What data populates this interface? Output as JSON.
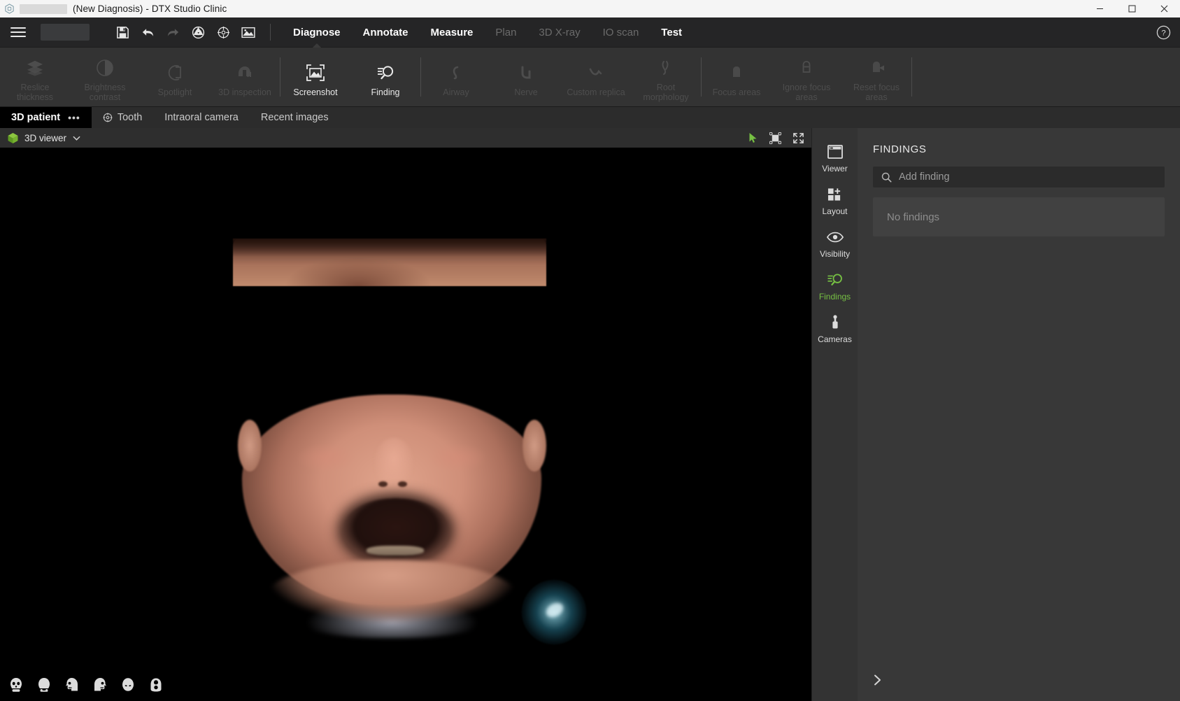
{
  "titlebar": {
    "app_icon": "dtx-app-icon",
    "patient_name_redacted": "",
    "title": "(New Diagnosis) - DTX Studio Clinic",
    "window_controls": [
      {
        "name": "minimize",
        "glyph": "minimize-icon"
      },
      {
        "name": "maximize",
        "glyph": "maximize-icon"
      },
      {
        "name": "close",
        "glyph": "close-icon"
      }
    ]
  },
  "menubar": {
    "hamburger": "hamburger-menu-icon",
    "tools": [
      {
        "name": "save-icon",
        "label": "Save",
        "disabled": false
      },
      {
        "name": "undo-icon",
        "label": "Undo",
        "disabled": false
      },
      {
        "name": "redo-icon",
        "label": "Redo",
        "disabled": true
      },
      {
        "name": "aperture-icon",
        "label": "Capture",
        "disabled": false
      },
      {
        "name": "crosshair-icon",
        "label": "Target",
        "disabled": false
      },
      {
        "name": "image-icon",
        "label": "Image",
        "disabled": false
      }
    ],
    "items": [
      {
        "label": "Diagnose",
        "active": true,
        "disabled": false
      },
      {
        "label": "Annotate",
        "active": false,
        "disabled": false
      },
      {
        "label": "Measure",
        "active": false,
        "disabled": false
      },
      {
        "label": "Plan",
        "active": false,
        "disabled": true
      },
      {
        "label": "3D X-ray",
        "active": false,
        "disabled": true
      },
      {
        "label": "IO scan",
        "active": false,
        "disabled": true
      },
      {
        "label": "Test",
        "active": false,
        "disabled": false
      }
    ],
    "help": "help-icon"
  },
  "ribbon": {
    "groups": [
      {
        "items": [
          {
            "label": "Reslice thickness",
            "icon": "layers-icon",
            "disabled": true
          },
          {
            "label": "Brightness contrast",
            "icon": "contrast-icon",
            "disabled": true
          },
          {
            "label": "Spotlight",
            "icon": "spotlight-icon",
            "disabled": true
          },
          {
            "label": "3D inspection",
            "icon": "inspection-icon",
            "disabled": true
          }
        ]
      },
      {
        "items": [
          {
            "label": "Screenshot",
            "icon": "screenshot-icon",
            "disabled": false
          },
          {
            "label": "Finding",
            "icon": "finding-icon",
            "disabled": false
          }
        ]
      },
      {
        "items": [
          {
            "label": "Airway",
            "icon": "airway-icon",
            "disabled": true
          },
          {
            "label": "Nerve",
            "icon": "nerve-icon",
            "disabled": true
          },
          {
            "label": "Custom replica",
            "icon": "replica-icon",
            "disabled": true
          },
          {
            "label": "Root morphology",
            "icon": "root-icon",
            "disabled": true
          }
        ]
      },
      {
        "items": [
          {
            "label": "Focus areas",
            "icon": "focus-area-icon",
            "disabled": true
          },
          {
            "label": "Ignore focus areas",
            "icon": "ignore-focus-icon",
            "disabled": true
          },
          {
            "label": "Reset focus areas",
            "icon": "reset-focus-icon",
            "disabled": true
          }
        ]
      }
    ]
  },
  "tabs": [
    {
      "label": "3D patient",
      "active": true,
      "icon": null,
      "menu": "•••"
    },
    {
      "label": "Tooth",
      "active": false,
      "icon": "tooth-target-icon"
    },
    {
      "label": "Intraoral camera",
      "active": false,
      "icon": null
    },
    {
      "label": "Recent images",
      "active": false,
      "icon": null
    }
  ],
  "viewer": {
    "cube_icon": "3d-cube-icon",
    "title": "3D viewer",
    "dropdown_icon": "chevron-down-icon",
    "controls": [
      {
        "name": "pointer-tool-icon",
        "color": "#76c043"
      },
      {
        "name": "fit-to-view-icon",
        "color": "#d8d8d8"
      },
      {
        "name": "fullscreen-icon",
        "color": "#d8d8d8"
      }
    ],
    "view_presets": [
      {
        "name": "view-front-icon"
      },
      {
        "name": "view-back-icon"
      },
      {
        "name": "view-left-icon"
      },
      {
        "name": "view-right-icon"
      },
      {
        "name": "view-top-icon"
      },
      {
        "name": "view-bottom-icon"
      }
    ]
  },
  "rail": [
    {
      "label": "Viewer",
      "icon": "viewer-window-icon",
      "active": false
    },
    {
      "label": "Layout",
      "icon": "layout-grid-icon",
      "active": false
    },
    {
      "label": "Visibility",
      "icon": "eye-icon",
      "active": false
    },
    {
      "label": "Findings",
      "icon": "finding-icon",
      "active": true
    },
    {
      "label": "Cameras",
      "icon": "camera-usb-icon",
      "active": false
    }
  ],
  "panel": {
    "title": "FINDINGS",
    "search_icon": "search-icon",
    "search_placeholder": "Add finding",
    "search_value": "",
    "empty_text": "No findings",
    "collapse_icon": "chevron-right-icon"
  },
  "colors": {
    "accent_green": "#76c043",
    "titlebar_bg": "#f5f5f5",
    "menubar_bg": "#252526",
    "ribbon_bg": "#333333",
    "panel_bg": "#383838",
    "canvas_bg": "#000000"
  }
}
